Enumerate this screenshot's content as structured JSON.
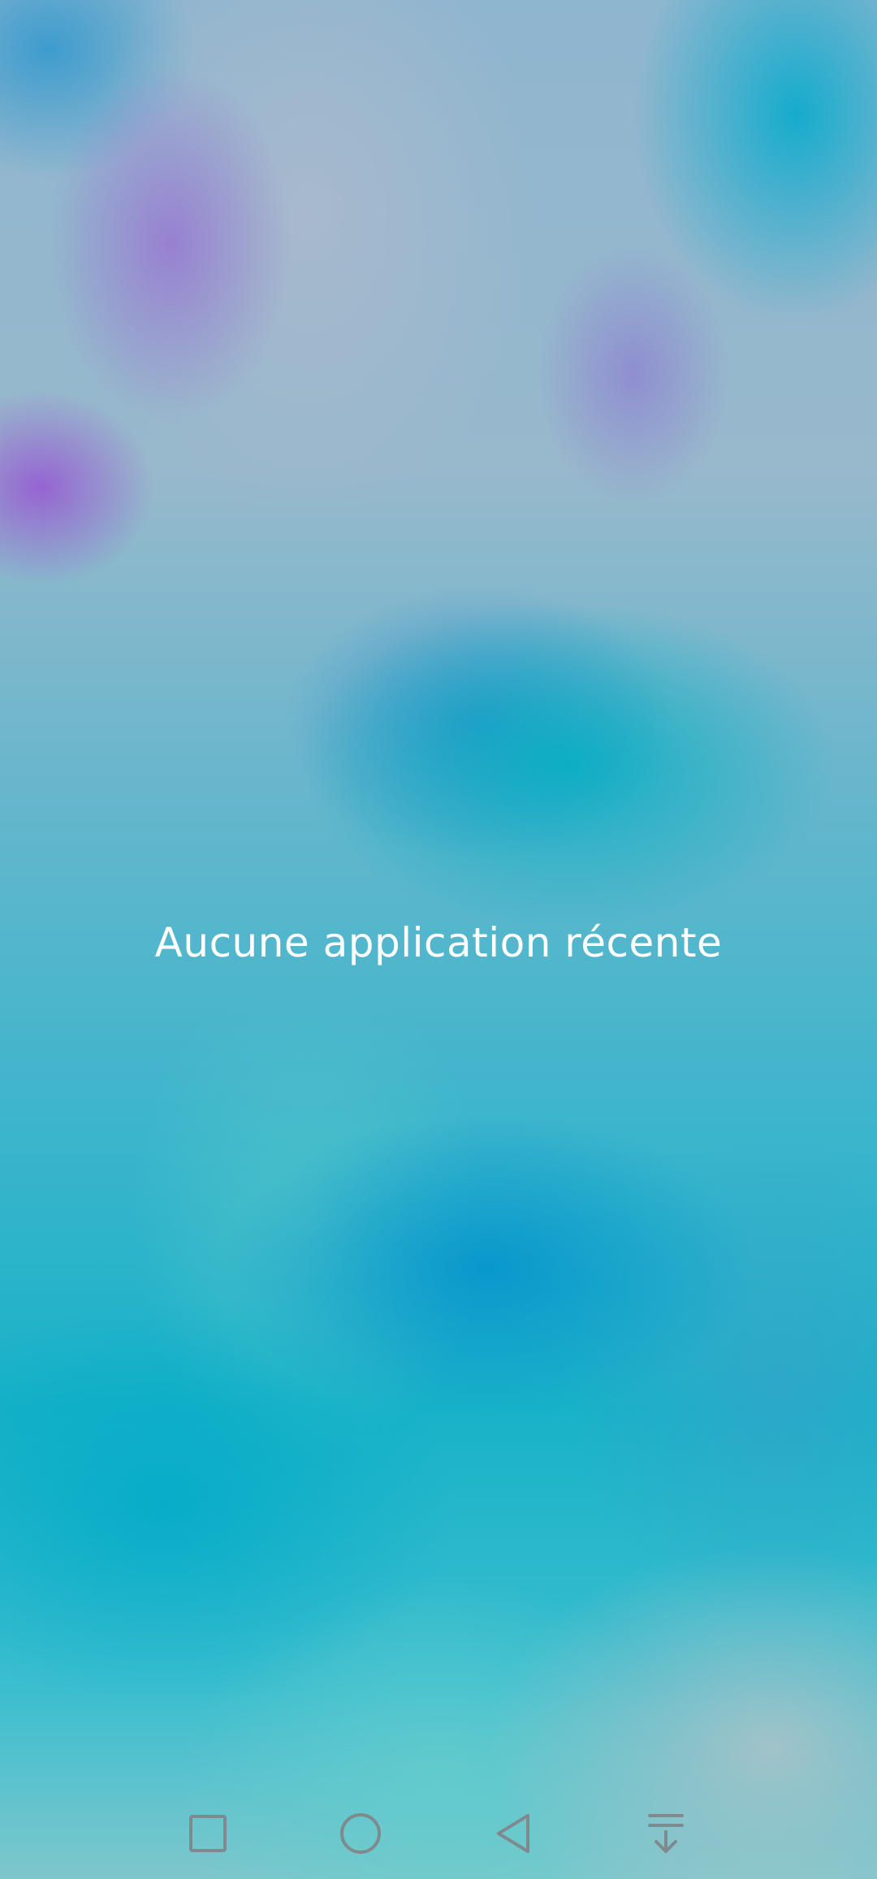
{
  "recents_screen": {
    "empty_message": "Aucune application récente"
  },
  "navigation_bar": {
    "buttons": [
      {
        "name": "recents",
        "icon": "square-icon"
      },
      {
        "name": "home",
        "icon": "circle-icon"
      },
      {
        "name": "back",
        "icon": "triangle-back-icon"
      },
      {
        "name": "notifications",
        "icon": "pull-down-icon"
      }
    ],
    "icon_color": "#7f8a8e"
  }
}
